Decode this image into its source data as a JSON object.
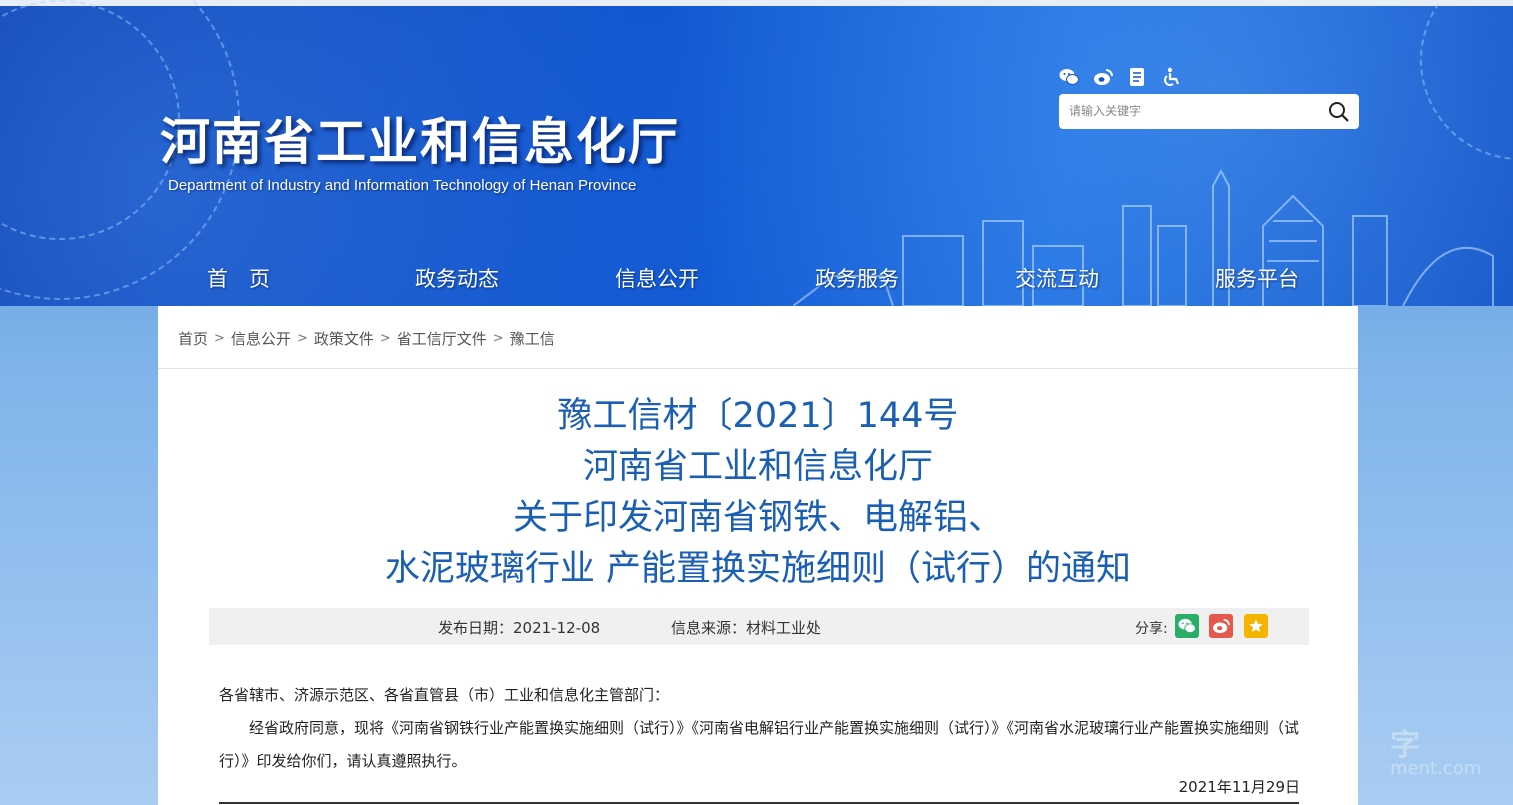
{
  "header": {
    "title": "河南省工业和信息化厅",
    "subtitle": "Department of Industry and Information Technology of Henan Province",
    "search_placeholder": "请输入关键字",
    "icons": [
      "wechat-icon",
      "weibo-icon",
      "document-icon",
      "accessibility-icon"
    ]
  },
  "nav": {
    "items": [
      {
        "label": "首　页"
      },
      {
        "label": "政务动态"
      },
      {
        "label": "信息公开"
      },
      {
        "label": "政务服务"
      },
      {
        "label": "交流互动"
      },
      {
        "label": "服务平台"
      }
    ]
  },
  "breadcrumb": {
    "items": [
      {
        "label": "首页"
      },
      {
        "label": "信息公开"
      },
      {
        "label": "政策文件"
      },
      {
        "label": "省工信厅文件"
      },
      {
        "label": "豫工信"
      }
    ],
    "separator": ">"
  },
  "document": {
    "title_lines": [
      "豫工信材〔2021〕144号",
      "河南省工业和信息化厅",
      "关于印发河南省钢铁、电解铝、",
      "水泥玻璃行业 产能置换实施细则（试行）的通知"
    ],
    "publish_date": "发布日期：2021-12-08",
    "source": "信息来源：材料工业处",
    "share_label": "分享:",
    "salutation": "各省辖市、济源示范区、各省直管县（市）工业和信息化主管部门：",
    "paragraph": "经省政府同意，现将《河南省钢铁行业产能置换实施细则（试行）》《河南省电解铝行业产能置换实施细则（试行）》《河南省水泥玻璃行业产能置换实施细则（试行）》印发给你们，请认真遵照执行。",
    "sign_date": "2021年11月29日"
  },
  "watermark": {
    "text": "字",
    "sub": "ment.com"
  },
  "colors": {
    "title_blue": "#1a5fb4",
    "header_blue": "#1156d0",
    "wechat_green": "#2aae67",
    "weibo_red": "#e6584c",
    "favorite_yellow": "#f4b400"
  }
}
